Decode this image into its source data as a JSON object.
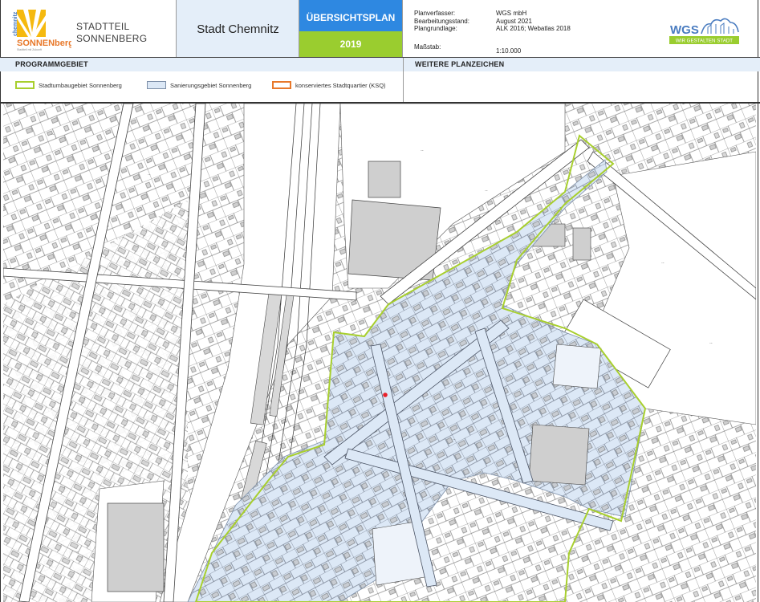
{
  "header": {
    "logo": {
      "word_top": "chemnitz",
      "word_main": "SONNENberg",
      "tagline": "Stadtteil mit Zukunft"
    },
    "district_line1": "STADTTEIL",
    "district_line2": "SONNENBERG",
    "city": "Stadt Chemnitz",
    "plan_title": "ÜBERSICHTSPLAN",
    "plan_year": "2019",
    "meta": [
      {
        "key": "Planverfasser:",
        "value": "WGS mbH"
      },
      {
        "key": "Bearbeitungsstand:",
        "value": "August 2021"
      },
      {
        "key": "Plangrundlage:",
        "value": "ALK 2016; Webatlas 2018"
      },
      {
        "key": "Maßstab:",
        "value": "1:10.000"
      }
    ],
    "wgs_logo": {
      "word": "WGS",
      "slogan": "WIR GESTALTEN STADT"
    }
  },
  "legend": {
    "section_left": "PROGRAMMGEBIET",
    "section_right": "WEITERE PLANZEICHEN",
    "items": [
      {
        "label": "Stadtumbaugebiet Sonnenberg",
        "border_color": "#a8cf2e",
        "fill": "#ffffff"
      },
      {
        "label": "Sanierungsgebiet Sonnenberg",
        "border_color": "#7d8fa8",
        "fill": "#dce8f6"
      },
      {
        "label": "konserviertes Stadtquartier (KSQ)",
        "border_color": "#e8782a",
        "fill": "#ffffff"
      }
    ]
  },
  "map": {
    "accent_colors": {
      "urban_renewal_outline": "#a8cf2e",
      "redevelopment_fill": "#dce8f6",
      "building_fill": "#cfcfcf",
      "marker": "#e8202a"
    }
  }
}
